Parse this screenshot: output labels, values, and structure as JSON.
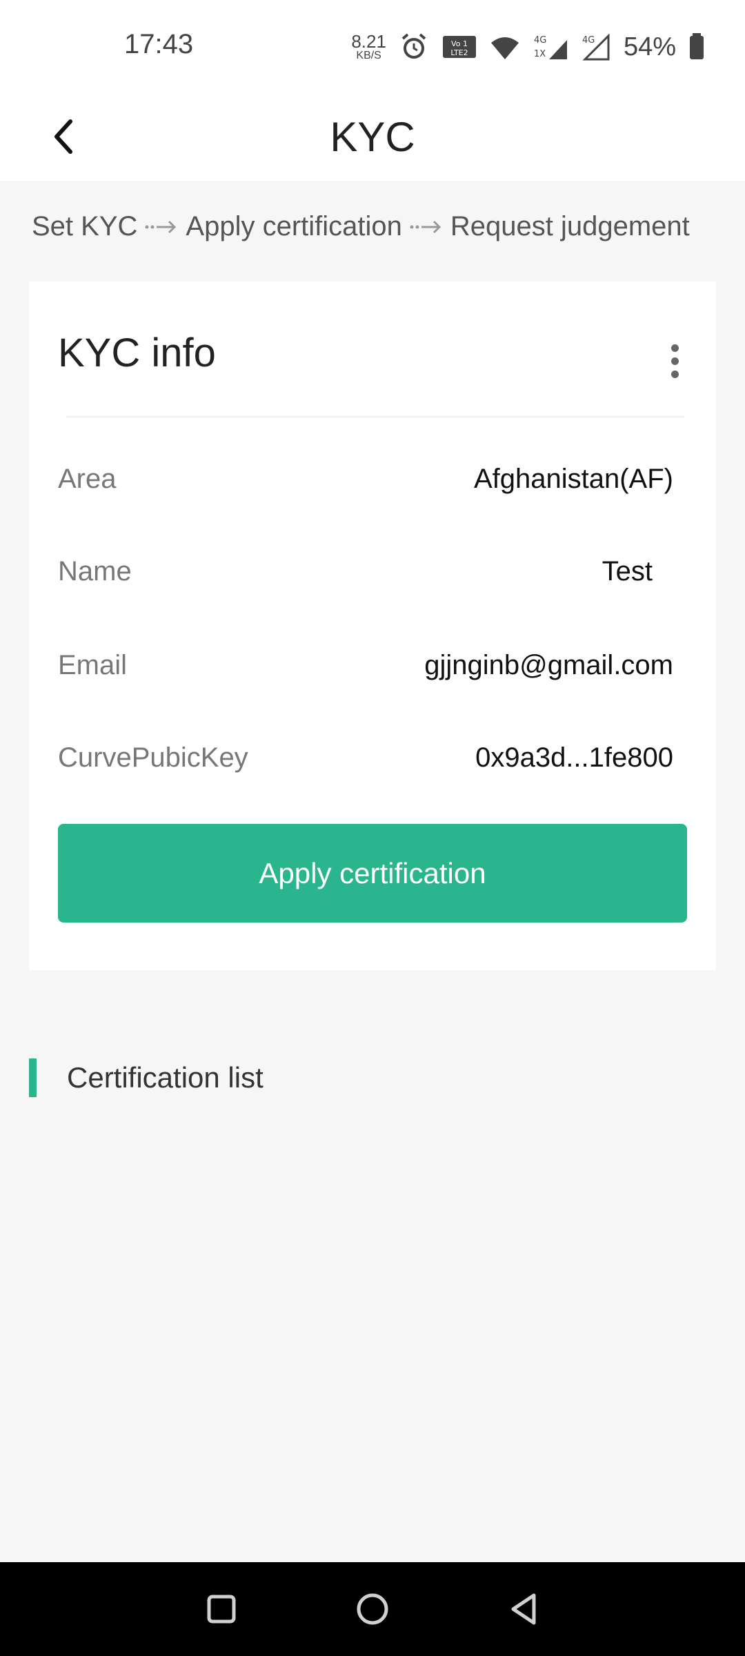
{
  "status_bar": {
    "time": "17:43",
    "net_speed_value": "8.21",
    "net_speed_unit": "KB/S",
    "battery": "54%",
    "icons": [
      "alarm-icon",
      "volte-icon",
      "wifi-icon",
      "signal-4g-1x-icon",
      "signal-4g-icon",
      "battery-icon"
    ]
  },
  "app_bar": {
    "title": "KYC",
    "back_icon": "chevron-left-icon"
  },
  "steps": [
    "Set KYC",
    "Apply certification",
    "Request judgement"
  ],
  "kyc_card": {
    "title": "KYC info",
    "rows": [
      {
        "label": "Area",
        "value": "Afghanistan(AF)"
      },
      {
        "label": "Name",
        "value": "Test"
      },
      {
        "label": "Email",
        "value": "gjjnginb@gmail.com"
      },
      {
        "label": "CurvePubicKey",
        "value": "0x9a3d...1fe800"
      }
    ],
    "button_label": "Apply certification"
  },
  "certification_section": {
    "title": "Certification list"
  },
  "nav_bar": {
    "icons": [
      "recents-icon",
      "home-icon",
      "back-icon"
    ]
  },
  "colors": {
    "accent": "#2bb58d",
    "background": "#f6f6f6",
    "card": "#ffffff"
  }
}
